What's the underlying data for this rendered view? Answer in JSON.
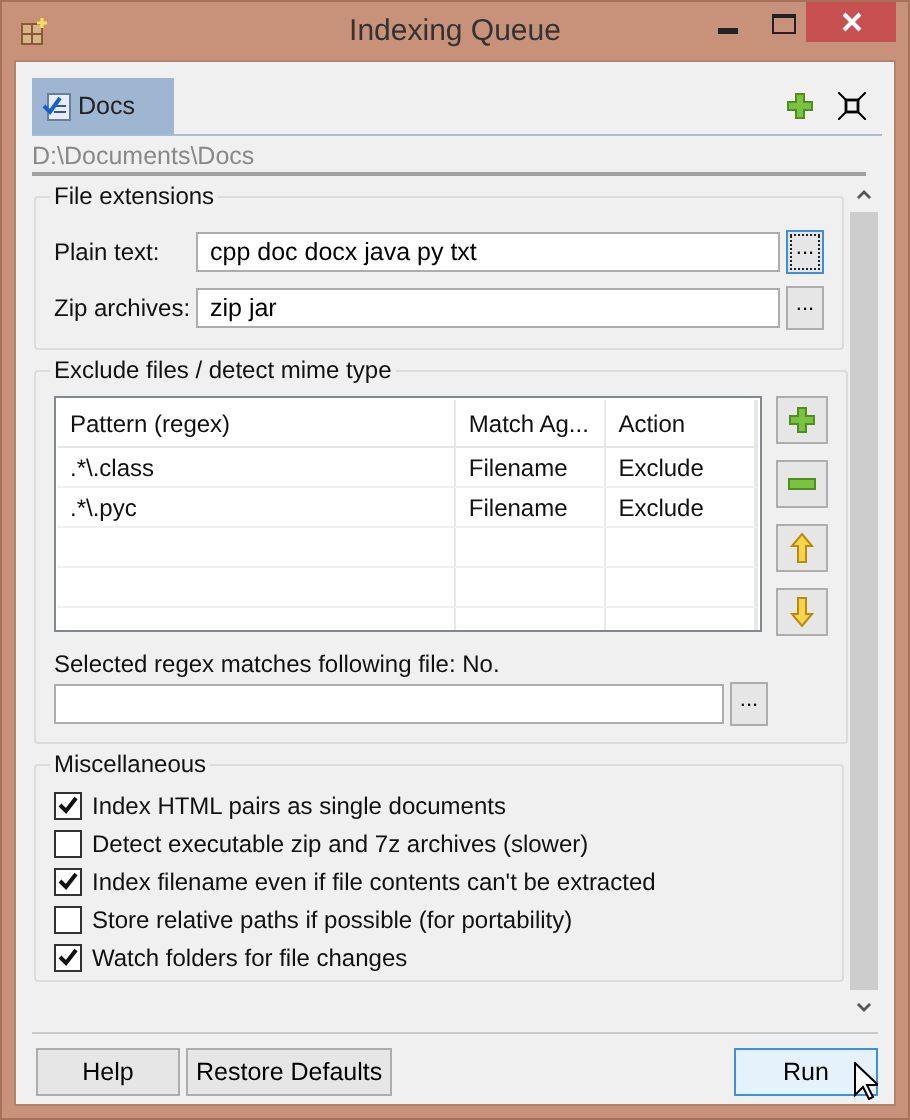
{
  "window": {
    "title": "Indexing Queue"
  },
  "tabs": [
    {
      "label": "Docs",
      "selected": true
    }
  ],
  "path": "D:\\Documents\\Docs",
  "file_extensions": {
    "title": "File extensions",
    "fields": [
      {
        "label": "Plain text:",
        "value": "cpp doc docx java py txt",
        "browse": "...",
        "focused": true
      },
      {
        "label": "Zip archives:",
        "value": "zip jar",
        "browse": "...",
        "focused": false
      }
    ]
  },
  "exclude": {
    "title": "Exclude files / detect mime type",
    "columns": [
      "Pattern (regex)",
      "Match Ag...",
      "Action"
    ],
    "rows": [
      [
        ".*\\.class",
        "Filename",
        "Exclude"
      ],
      [
        ".*\\.pyc",
        "Filename",
        "Exclude"
      ]
    ],
    "match_label": "Selected regex matches following file: No.",
    "browse": "..."
  },
  "misc": {
    "title": "Miscellaneous",
    "options": [
      {
        "label": "Index HTML pairs as single documents",
        "checked": true
      },
      {
        "label": "Detect executable zip and 7z archives (slower)",
        "checked": false
      },
      {
        "label": "Index filename even if file contents can't be extracted",
        "checked": true
      },
      {
        "label": "Store relative paths if possible (for portability)",
        "checked": false
      },
      {
        "label": "Watch folders for file changes",
        "checked": true
      }
    ]
  },
  "buttons": [
    {
      "label": "Help",
      "default": false
    },
    {
      "label": "Restore Defaults",
      "default": false
    },
    {
      "label": "Run",
      "default": true
    }
  ]
}
